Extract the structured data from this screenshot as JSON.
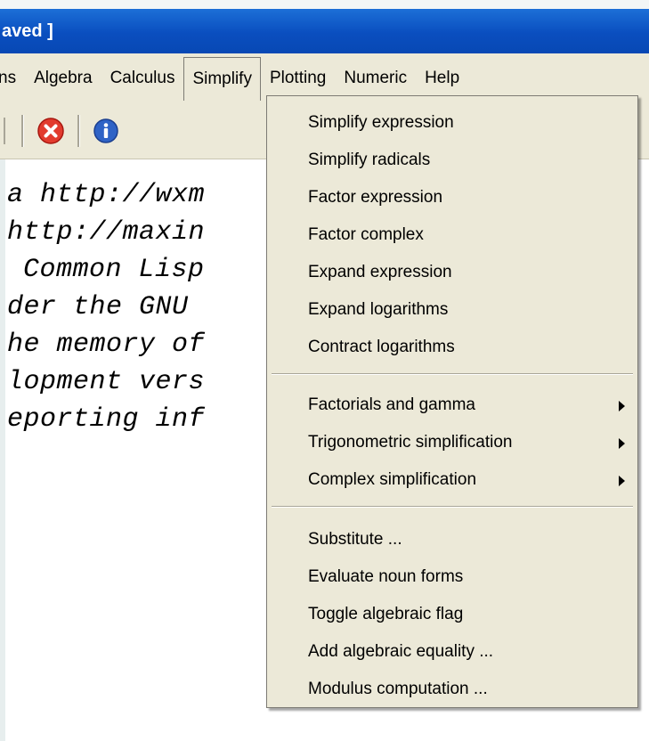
{
  "window": {
    "title_fragment": "aved ]"
  },
  "menubar": {
    "items": [
      "ns",
      "Algebra",
      "Calculus",
      "Simplify",
      "Plotting",
      "Numeric",
      "Help"
    ]
  },
  "toolbar": {
    "icons": [
      "stop-icon",
      "info-icon"
    ],
    "colors": {
      "stop": "#e23b2e",
      "info": "#2f63c6"
    }
  },
  "console": {
    "lines": [
      "a http://wxm",
      "http://maxin",
      "Common Lisp",
      "der the GNU",
      "he memory of",
      "lopment vers",
      "eporting inf"
    ]
  },
  "simplify_menu": {
    "group1": [
      "Simplify expression",
      "Simplify radicals",
      "Factor expression",
      "Factor complex",
      "Expand expression",
      "Expand logarithms",
      "Contract logarithms"
    ],
    "group2": [
      "Factorials and gamma",
      "Trigonometric simplification",
      "Complex simplification"
    ],
    "group3": [
      "Substitute ...",
      "Evaluate noun forms",
      "Toggle algebraic flag",
      "Add algebraic equality ...",
      "Modulus computation ..."
    ]
  }
}
